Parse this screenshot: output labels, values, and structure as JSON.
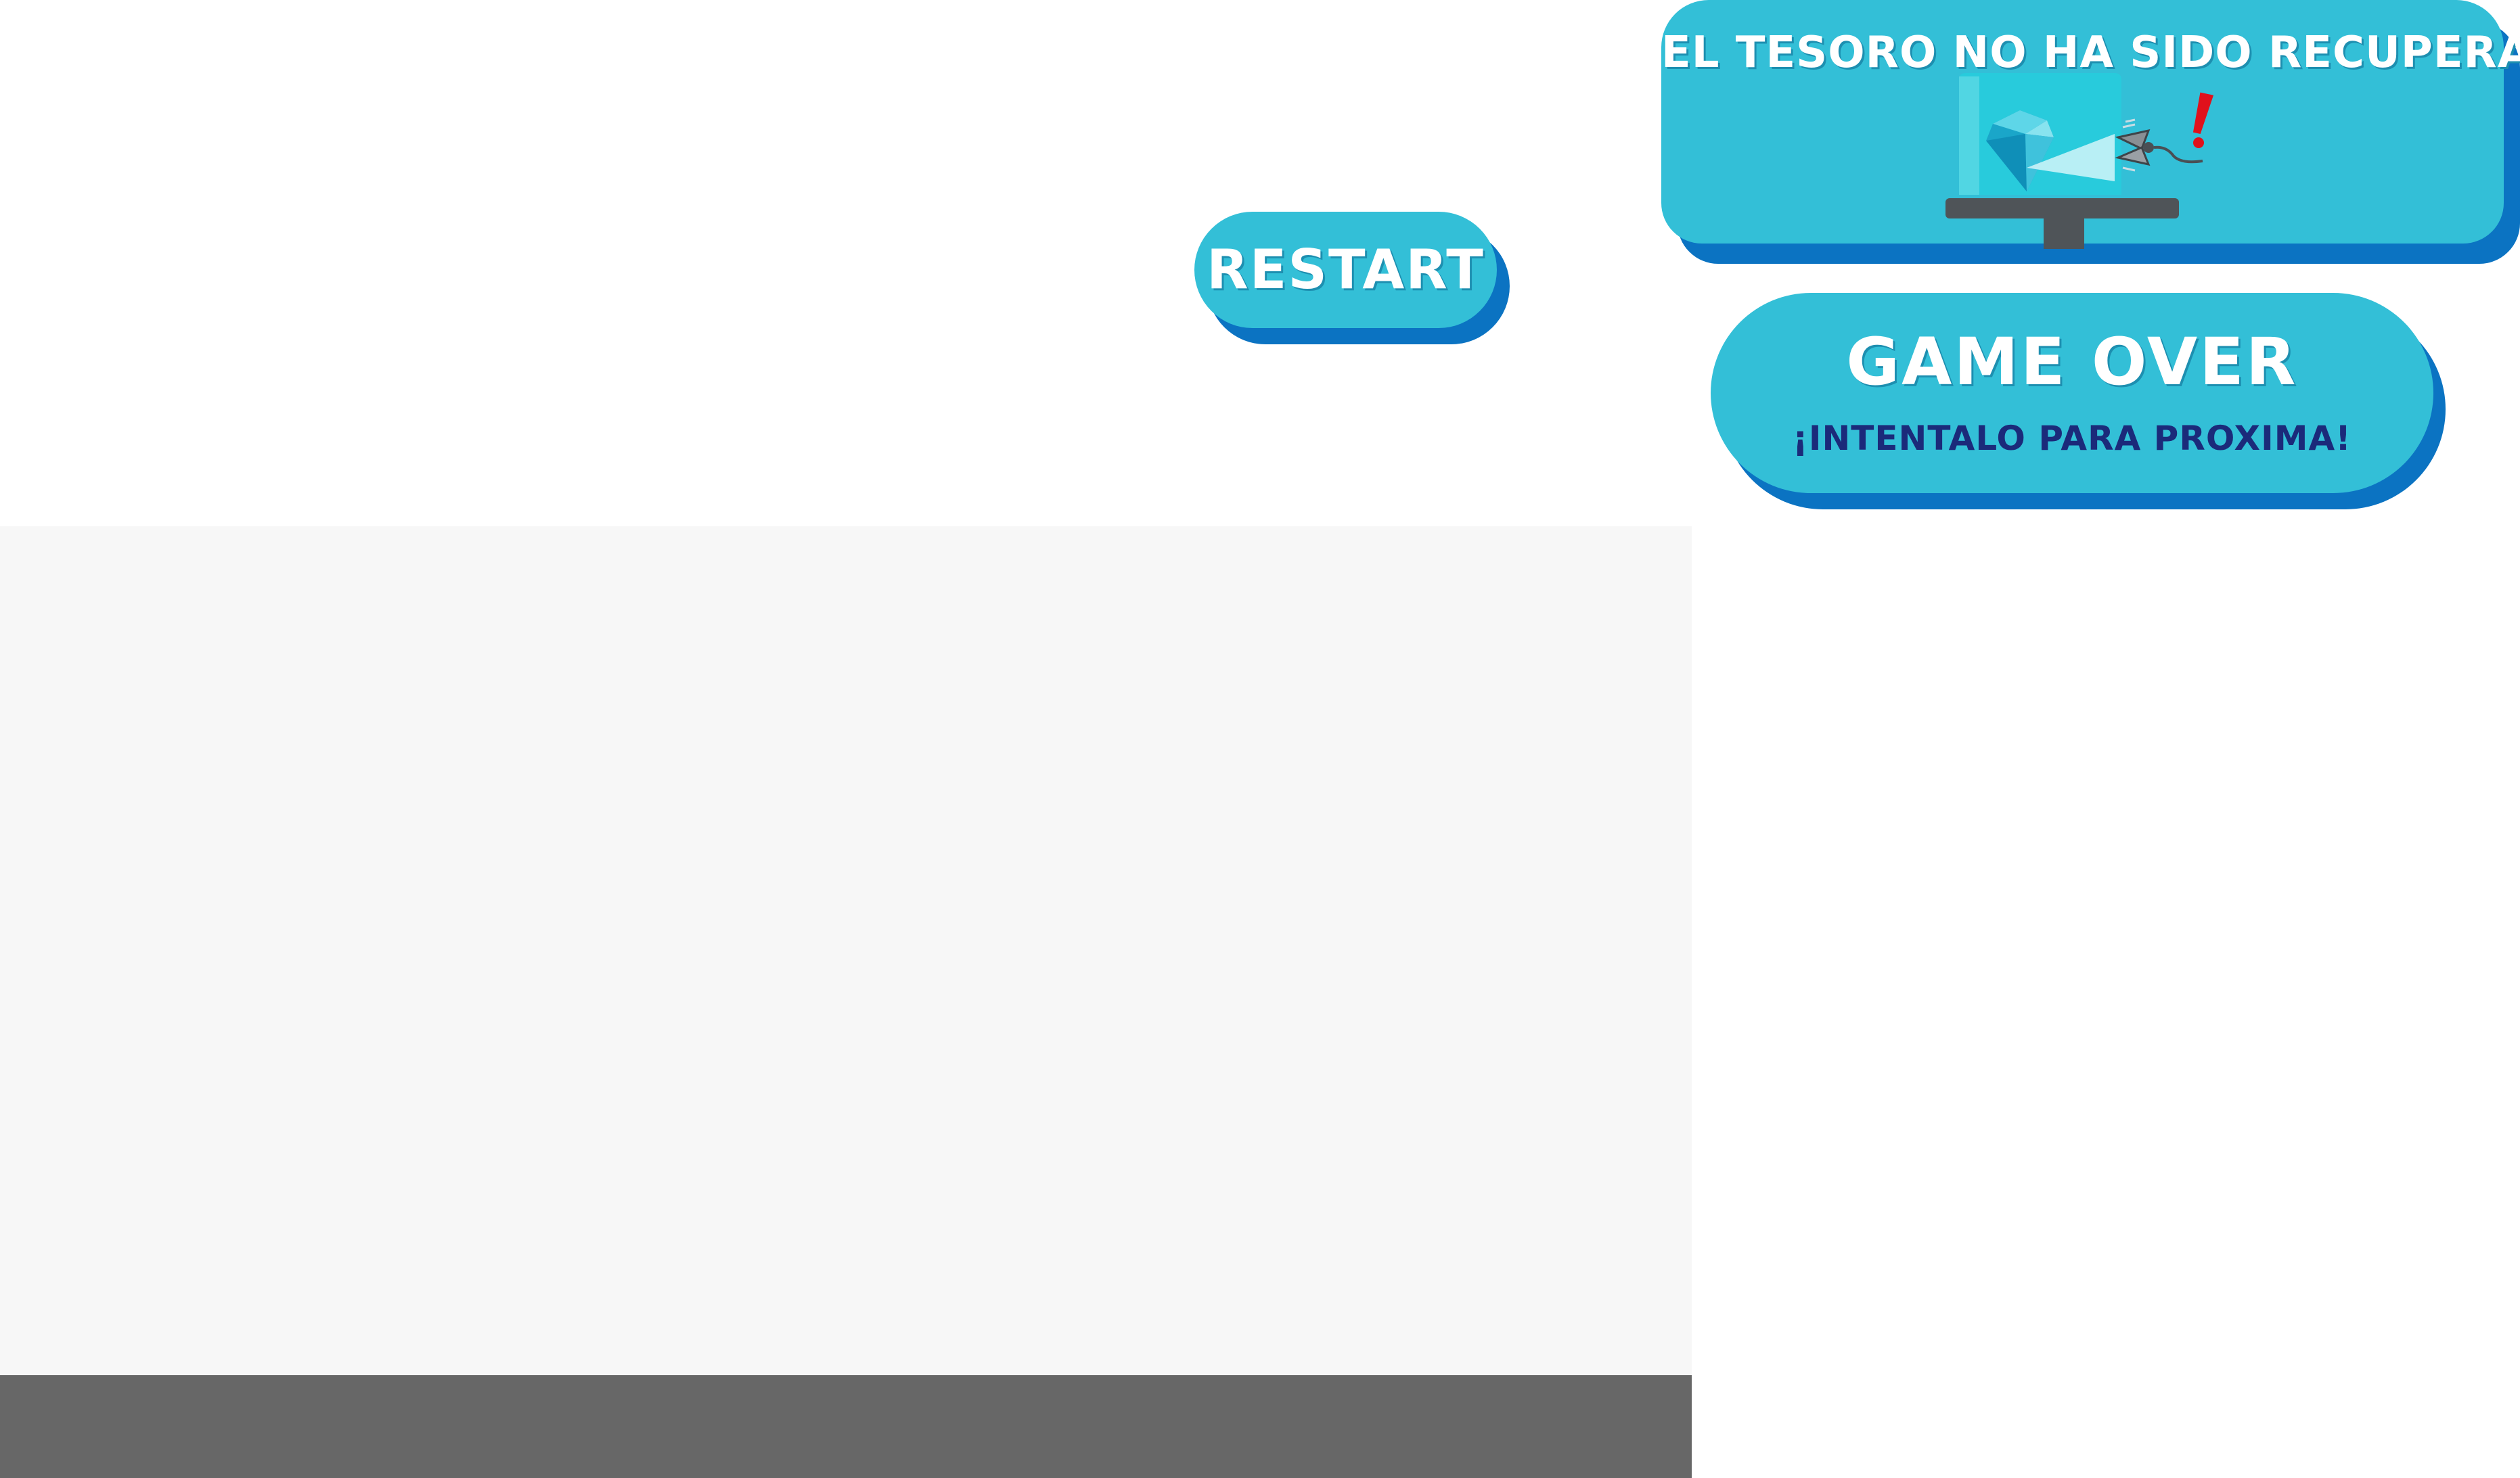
{
  "restart": {
    "label": "Restart"
  },
  "status": {
    "title": "El tesoro no ha sido recuperado",
    "alert": "!"
  },
  "gameover": {
    "title": "Game Over",
    "subtitle": "¡Intentalo para proxima!"
  },
  "colors": {
    "panel": "#33bfd7",
    "panel_shadow": "#0b73c2",
    "subtitle_text": "#1b2a7a",
    "alert": "#e0111b",
    "game_area": "#f7f7f7",
    "floor": "#676767"
  },
  "icons": [
    "diamond-icon",
    "grabber-claw-icon",
    "alert-exclamation-icon",
    "monitor-stand-icon"
  ]
}
